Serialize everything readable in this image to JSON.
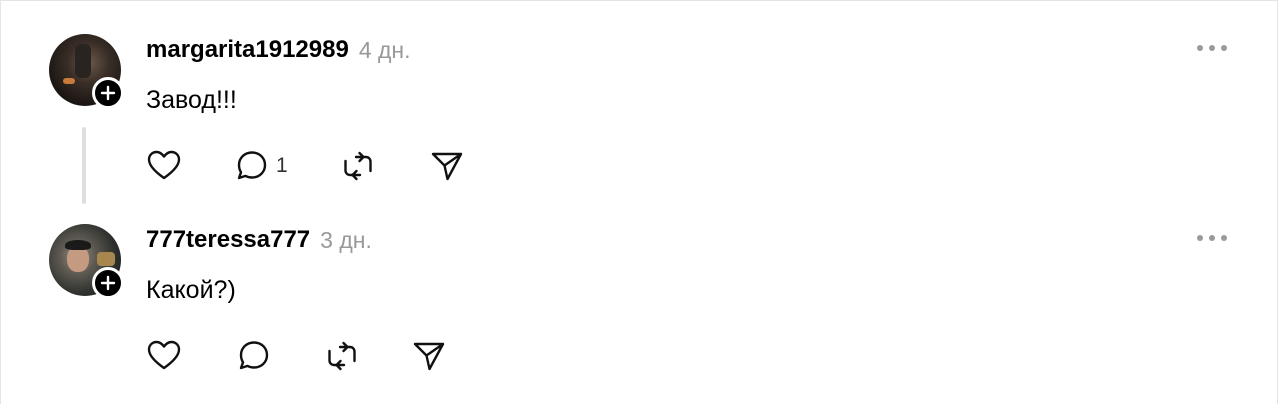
{
  "comments": [
    {
      "username": "margarita1912989",
      "time": "4 дн.",
      "text": "Завод!!!",
      "reply_count": "1"
    },
    {
      "username": "777teressa777",
      "time": "3 дн.",
      "text": "Какой?)",
      "reply_count": ""
    }
  ],
  "icons": {
    "like": "heart-icon",
    "reply": "comment-icon",
    "repost": "repost-icon",
    "share": "send-icon",
    "more": "more-icon",
    "follow": "plus-icon"
  },
  "colors": {
    "text": "#000000",
    "muted": "#999999",
    "thread_line": "#dedede"
  }
}
